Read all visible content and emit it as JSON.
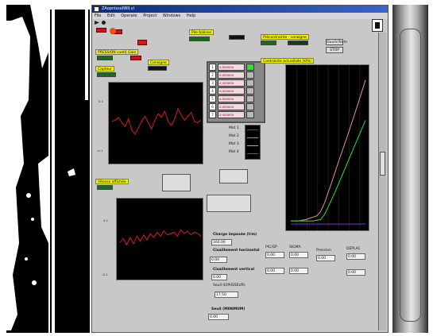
{
  "window": {
    "title": "ZAopnissoIWII.vi",
    "menu": [
      "File",
      "Edit",
      "Operate",
      "Project",
      "Windows",
      "Help"
    ]
  },
  "labels": {
    "pressure_label": "PRESSION cuelle",
    "gain_label": "Gain",
    "consigne_label": "Consigne",
    "capteur_label": "Capteur",
    "perte_label": "Perte ajustée",
    "vitesse_label": "Vitesse affichée",
    "contrainte_label": "Contrainte actualisée (kPa)",
    "charge_label": "Charge imposée (t/m)",
    "cisaillement_h_label": "Cisaillement horizontal",
    "cisaillement_v_label": "Cisaillement vertical",
    "seuil_label": "Seuil (EPAISSEUR)",
    "seuil2_label": "Seuil (MINIMUM)",
    "top_label_1": "Pile balises",
    "top_label_2": "Précontrainte - consigne"
  },
  "buttons": {
    "btn_ouvre": "Ouvrir/ferm",
    "btn_stop": "STOP"
  },
  "fields": {
    "charge_value": "160.00",
    "cisaillement_h_value": "0.00",
    "cisaillement_v_value": "0.00",
    "seuil_value": "17.50",
    "seuil2_value": "0.00",
    "ltr1_value": "0.00",
    "ltr2_value": "0.00",
    "ltr3_value": "0.00",
    "ltr4_value": "0.00",
    "ltr5_value": "0.00",
    "ltr6_value": "0.00",
    "bottom_labels": [
      "PIC/GP",
      "SIGMA",
      "Pression",
      "DEPLAC"
    ]
  },
  "list": [
    {
      "n": "1",
      "v": "0.000000"
    },
    {
      "n": "2",
      "v": "0.000000"
    },
    {
      "n": "3",
      "v": "0.000000"
    },
    {
      "n": "4",
      "v": "0.000000"
    },
    {
      "n": "5",
      "v": "0.000000"
    },
    {
      "n": "6",
      "v": "0.000000"
    },
    {
      "n": "7",
      "v": "0.000000"
    }
  ],
  "legend": [
    "Mat 1",
    "Mat 2",
    "Mat 3",
    "Mat 4"
  ],
  "colors": {
    "trace_red": "#e01818",
    "trace_green": "#2ee02e",
    "trace_pink": "#e89090",
    "trace_purple": "#8a2ad8",
    "accent_yellow": "#f4f400"
  },
  "chart_data": [
    {
      "type": "line",
      "series": [
        {
          "values": [
            0.02,
            0.03,
            0.05,
            0.01,
            -0.02,
            0.04,
            -0.05,
            -0.08,
            -0.03,
            0.02,
            0.06,
            0.01,
            -0.04,
            0.03,
            0.08,
            0.05,
            0.1,
            0.02,
            -0.01,
            0.04,
            0.12,
            0.07,
            0.03,
            0.06,
            0.09,
            0.02,
            0.01,
            0.03
          ]
        }
      ],
      "x": [
        0,
        5,
        10,
        15,
        20,
        25,
        30,
        35,
        40,
        45,
        50,
        55,
        60,
        65,
        70,
        75,
        80,
        85,
        90,
        95,
        100,
        105,
        110,
        115,
        120,
        125,
        130,
        135
      ],
      "ylim": [
        -0.3,
        0.3
      ],
      "ticks_y": [
        "0.1",
        "-0.1"
      ]
    },
    {
      "type": "line",
      "series": [
        {
          "values": [
            -0.02,
            0.01,
            -0.04,
            0.02,
            -0.03,
            0.03,
            -0.01,
            0.04,
            0.0,
            0.05,
            0.02,
            0.06,
            0.03,
            0.07,
            0.04,
            0.05,
            0.06,
            0.03,
            0.08,
            0.05,
            0.07,
            0.04,
            0.06,
            0.05,
            0.03
          ]
        }
      ],
      "x": [
        0,
        5,
        10,
        15,
        20,
        25,
        30,
        35,
        40,
        45,
        50,
        55,
        60,
        65,
        70,
        75,
        80,
        85,
        90,
        95,
        100,
        105,
        110,
        115,
        120
      ],
      "ylim": [
        -0.3,
        0.3
      ],
      "ticks_y": [
        "0.1",
        "-0.1"
      ]
    },
    {
      "type": "line",
      "series": [
        {
          "values": [
            0,
            0,
            0,
            1,
            2,
            4,
            6,
            8,
            15,
            28,
            45,
            62,
            80,
            98,
            115,
            132,
            150,
            168,
            186,
            205,
            224
          ]
        },
        {
          "values": [
            0,
            0,
            0,
            0,
            0,
            0,
            0,
            1,
            2,
            10,
            22,
            35,
            48,
            62,
            76,
            90,
            104,
            118,
            132,
            146,
            160
          ]
        },
        {
          "values": [
            -5,
            -5,
            -5,
            -5,
            -5,
            -5,
            -5,
            -5,
            -5,
            -5,
            -5,
            -5,
            -5,
            -5,
            -5,
            -5,
            -5,
            -5,
            -5,
            -5,
            -5
          ]
        }
      ],
      "x": [
        0,
        5,
        10,
        15,
        20,
        25,
        30,
        35,
        40,
        45,
        50,
        55,
        60,
        65,
        70,
        75,
        80,
        85,
        90,
        95,
        100
      ],
      "ylim": [
        -10,
        240
      ]
    }
  ]
}
